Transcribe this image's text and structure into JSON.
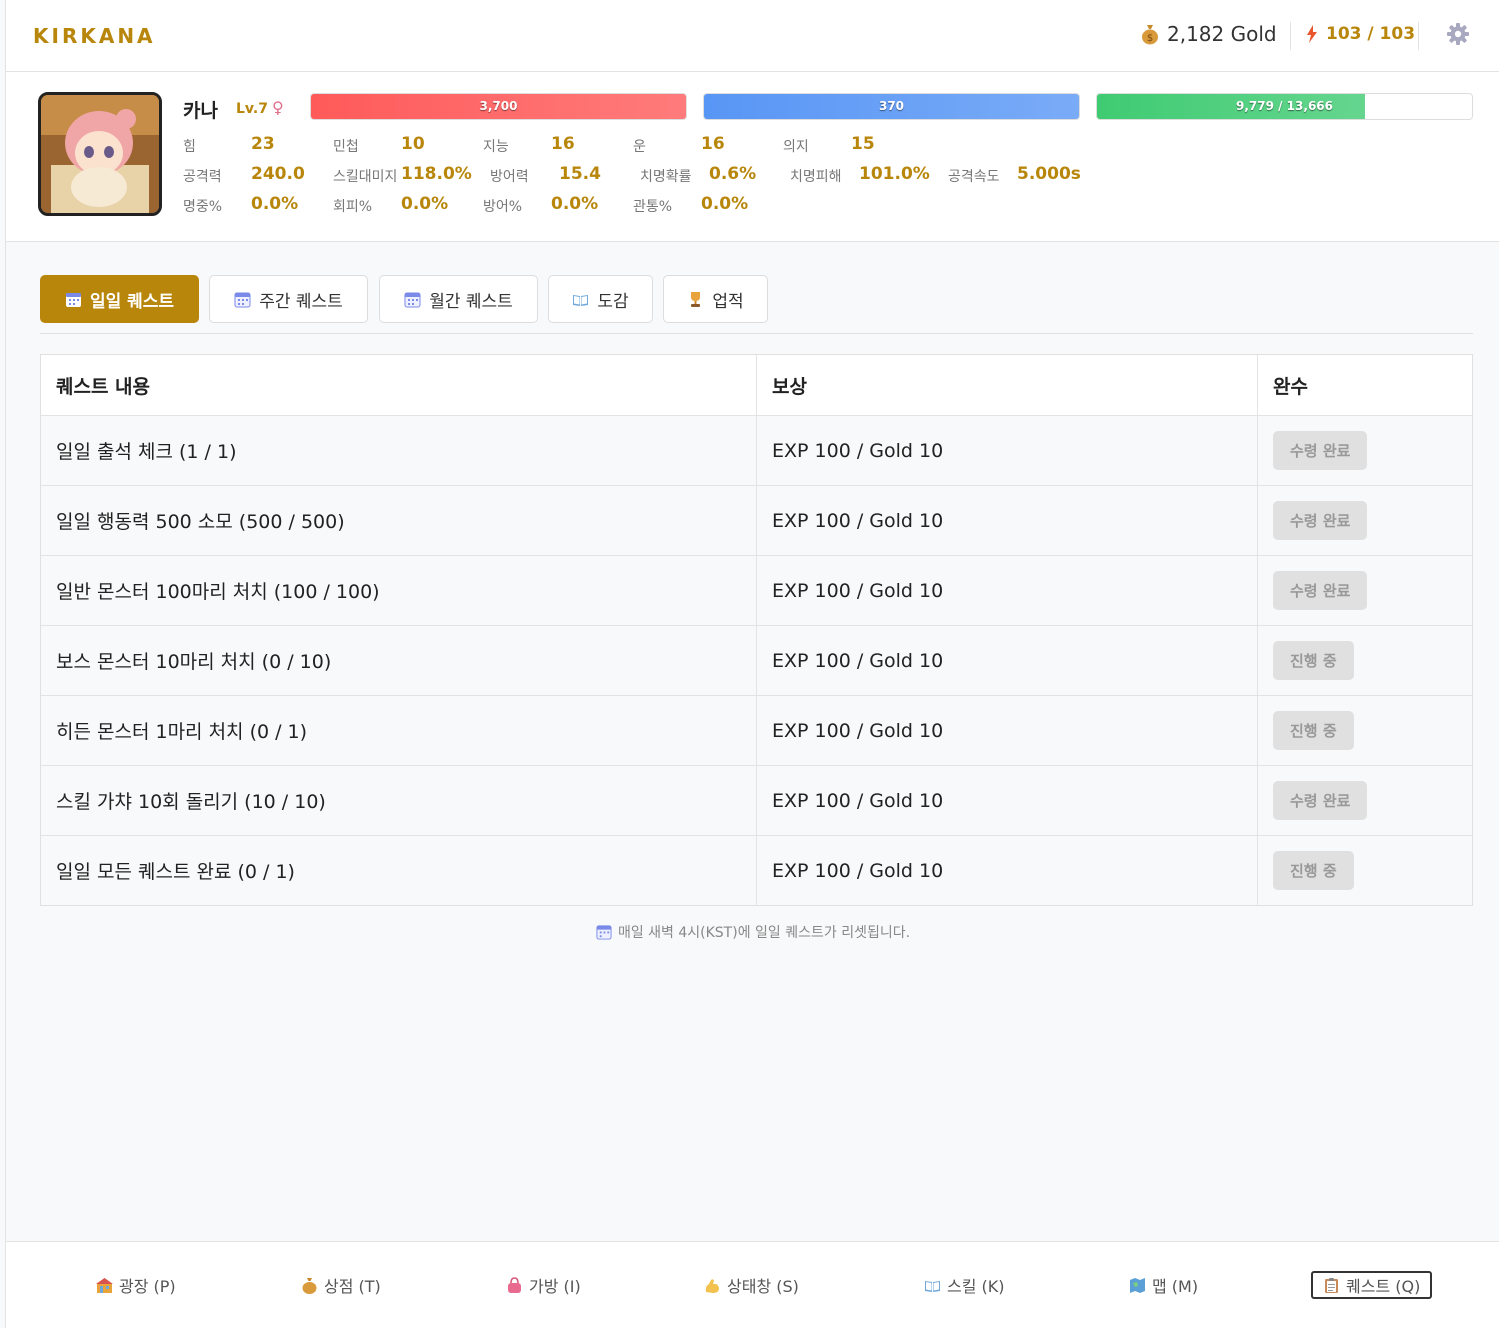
{
  "header": {
    "logo": "KIRKANA",
    "gold": "2,182 Gold",
    "energy": "103 / 103",
    "colors": {
      "accent": "#b8860b",
      "energy_icon": "#e8552e"
    }
  },
  "profile": {
    "name": "카나",
    "level": "Lv.7",
    "sex": "♀",
    "bars": [
      {
        "label": "3,700",
        "ratio": 1.0,
        "color": "#ff5a5a"
      },
      {
        "label": "370",
        "ratio": 1.0,
        "color": "#5896f5"
      },
      {
        "label": "9,779 / 13,666",
        "ratio": 0.7156,
        "color": "#3fcb72"
      }
    ],
    "stats": [
      {
        "label": "힘",
        "value": "23"
      },
      {
        "label": "민첩",
        "value": "10"
      },
      {
        "label": "지능",
        "value": "16"
      },
      {
        "label": "운",
        "value": "16"
      },
      {
        "label": "의지",
        "value": "15"
      },
      {
        "label": "공격력",
        "value": "240.0"
      },
      {
        "label": "스킬대미지",
        "value": "118.0%"
      },
      {
        "label": "방어력",
        "value": "15.4"
      },
      {
        "label": "치명확률",
        "value": "0.6%"
      },
      {
        "label": "치명피해",
        "value": "101.0%"
      },
      {
        "label": "공격속도",
        "value": "5.000s"
      },
      {
        "label": "명중%",
        "value": "0.0%"
      },
      {
        "label": "회피%",
        "value": "0.0%"
      },
      {
        "label": "방어%",
        "value": "0.0%"
      },
      {
        "label": "관통%",
        "value": "0.0%"
      }
    ]
  },
  "tabs": [
    {
      "label": "일일 퀘스트",
      "icon": "calendar-icon",
      "active": true
    },
    {
      "label": "주간 퀘스트",
      "icon": "calendar-icon",
      "active": false
    },
    {
      "label": "월간 퀘스트",
      "icon": "calendar-icon",
      "active": false
    },
    {
      "label": "도감",
      "icon": "book-icon",
      "active": false
    },
    {
      "label": "업적",
      "icon": "trophy-icon",
      "active": false
    }
  ],
  "table": {
    "headers": [
      "퀘스트 내용",
      "보상",
      "완수"
    ],
    "rows": [
      {
        "quest": "일일 출석 체크 (1 / 1)",
        "reward": "EXP 100 / Gold 10",
        "status": "수령 완료"
      },
      {
        "quest": "일일 행동력 500 소모 (500 / 500)",
        "reward": "EXP 100 / Gold 10",
        "status": "수령 완료"
      },
      {
        "quest": "일반 몬스터 100마리 처치 (100 / 100)",
        "reward": "EXP 100 / Gold 10",
        "status": "수령 완료"
      },
      {
        "quest": "보스 몬스터 10마리 처치 (0 / 10)",
        "reward": "EXP 100 / Gold 10",
        "status": "진행 중"
      },
      {
        "quest": "히든 몬스터 1마리 처치 (0 / 1)",
        "reward": "EXP 100 / Gold 10",
        "status": "진행 중"
      },
      {
        "quest": "스킬 가챠 10회 돌리기 (10 / 10)",
        "reward": "EXP 100 / Gold 10",
        "status": "수령 완료"
      },
      {
        "quest": "일일 모든 퀘스트 완료 (0 / 1)",
        "reward": "EXP 100 / Gold 10",
        "status": "진행 중"
      }
    ]
  },
  "footnote": "매일 새벽 4시(KST)에 일일 퀘스트가 리셋됩니다.",
  "bottom_nav": [
    {
      "label": "광장 (P)",
      "icon": "plaza-icon",
      "active": false
    },
    {
      "label": "상점 (T)",
      "icon": "money-bag-icon",
      "active": false
    },
    {
      "label": "가방 (I)",
      "icon": "bag-icon",
      "active": false
    },
    {
      "label": "상태창 (S)",
      "icon": "muscle-icon",
      "active": false
    },
    {
      "label": "스킬 (K)",
      "icon": "book-icon",
      "active": false
    },
    {
      "label": "맵 (M)",
      "icon": "map-icon",
      "active": false
    },
    {
      "label": "퀘스트 (Q)",
      "icon": "clipboard-icon",
      "active": true
    }
  ]
}
